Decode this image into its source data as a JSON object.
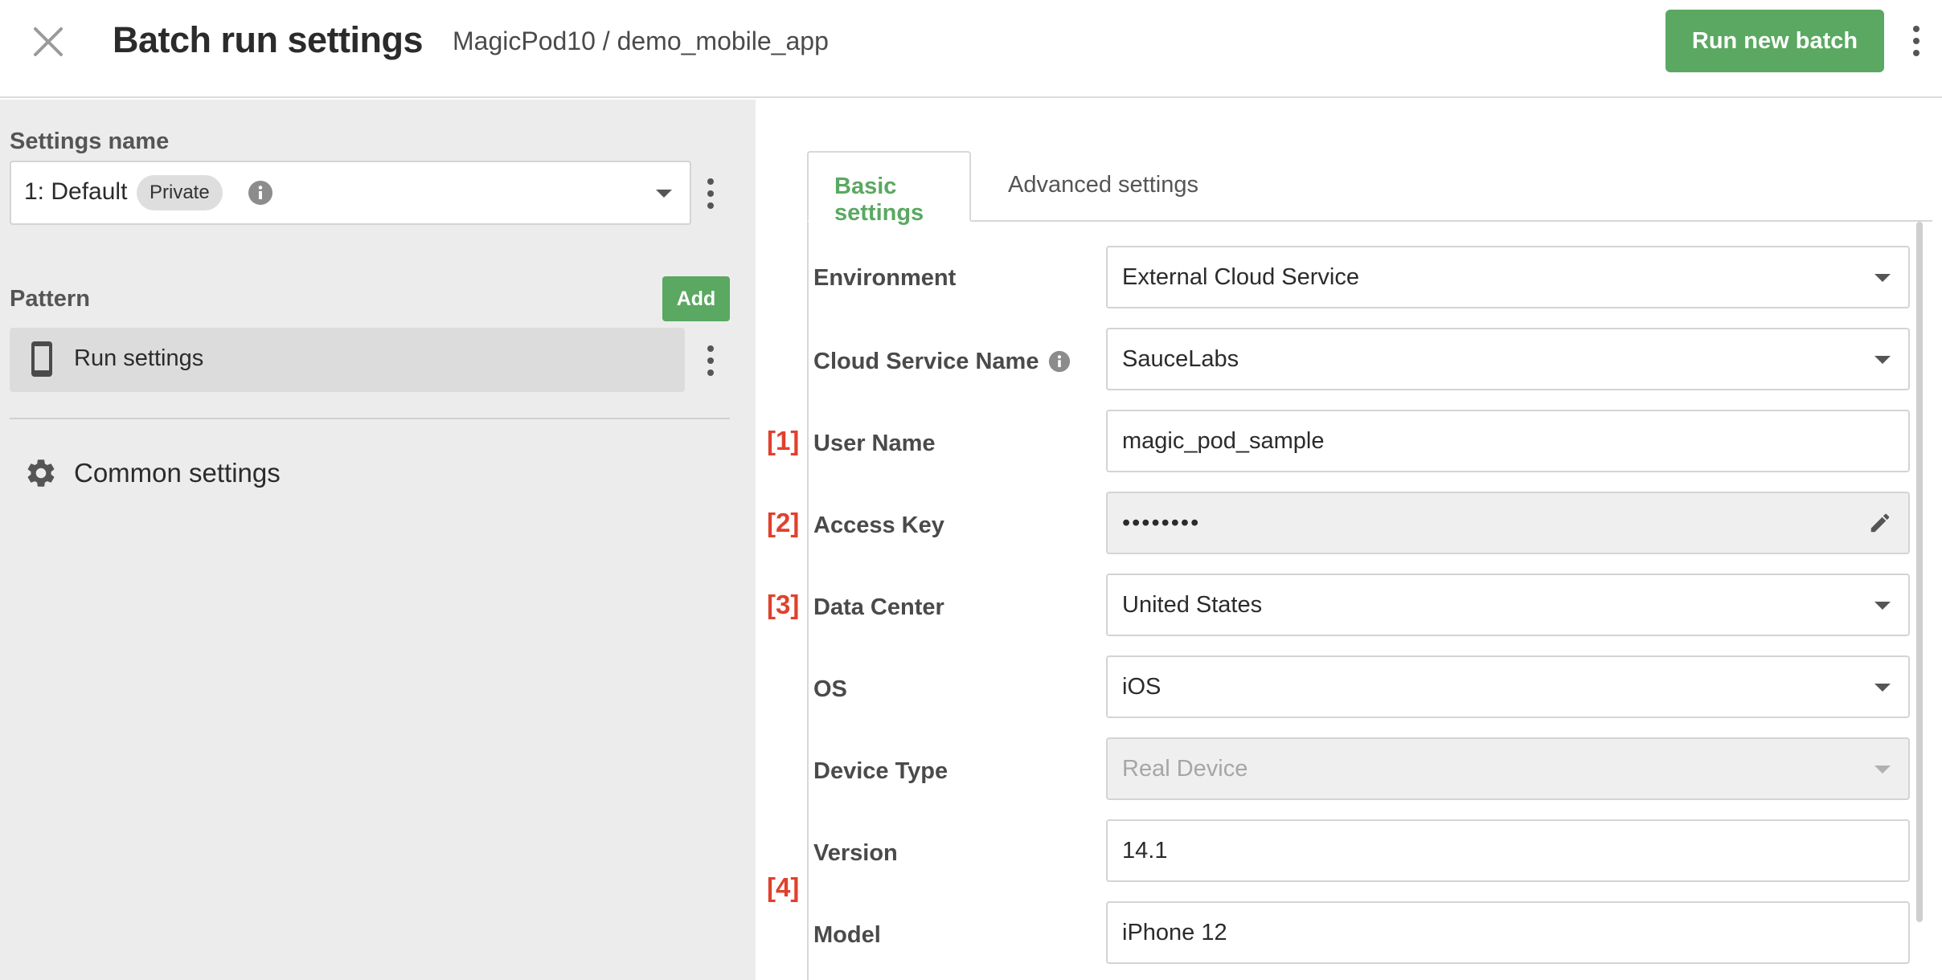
{
  "header": {
    "title": "Batch run settings",
    "breadcrumb": "MagicPod10 / demo_mobile_app",
    "run_button_label": "Run new batch",
    "accent_color": "#5aa861"
  },
  "sidebar": {
    "settings_name_label": "Settings name",
    "settings_selected": "1: Default",
    "settings_badge": "Private",
    "pattern_label": "Pattern",
    "add_button_label": "Add",
    "pattern_items": [
      {
        "label": "Run settings",
        "icon": "mobile-phone-icon"
      }
    ],
    "common_settings_label": "Common settings",
    "common_settings_icon": "gear-icon"
  },
  "tabs": [
    {
      "label": "Basic settings",
      "active": true
    },
    {
      "label": "Advanced settings",
      "active": false
    }
  ],
  "form": {
    "environment": {
      "label": "Environment",
      "value": "External Cloud Service"
    },
    "cloud_service_name": {
      "label": "Cloud Service Name",
      "value": "SauceLabs"
    },
    "user_name": {
      "marker": "[1]",
      "label": "User Name",
      "value": "magic_pod_sample"
    },
    "access_key": {
      "marker": "[2]",
      "label": "Access Key",
      "value": "••••••••"
    },
    "data_center": {
      "marker": "[3]",
      "label": "Data Center",
      "value": "United States"
    },
    "os": {
      "label": "OS",
      "value": "iOS"
    },
    "device_type": {
      "label": "Device Type",
      "value": "Real Device"
    },
    "version_model_marker": "[4]",
    "version": {
      "label": "Version",
      "value": "14.1"
    },
    "model": {
      "label": "Model",
      "value": "iPhone 12"
    }
  },
  "colors": {
    "marker_red": "#e0412e",
    "sidebar_bg": "#ececec"
  }
}
